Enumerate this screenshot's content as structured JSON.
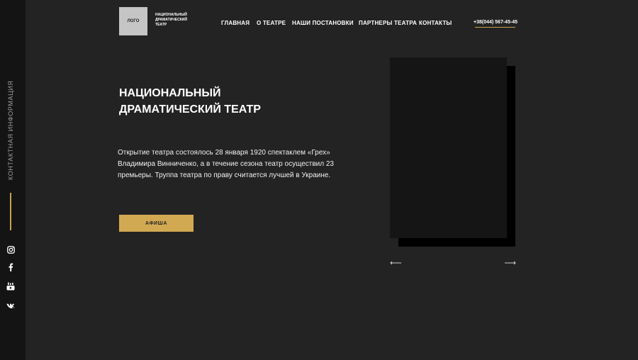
{
  "sidebar": {
    "contact_label": "КОНТАКТНАЯ ИНФОРМАЦИЯ",
    "social": [
      "instagram-icon",
      "facebook-icon",
      "youtube-icon",
      "vk-icon"
    ]
  },
  "header": {
    "logo_label": "ЛОГО",
    "logo_caption": "НАЦИОНАЛЬНЫЙ ДРАМАТИЧЕСКИЙ ТЕАТР",
    "nav": [
      "ГЛАВНАЯ",
      "О ТЕАТРЕ",
      "НАШИ ПОСТАНОВКИ",
      "ПАРТНЕРЫ ТЕАТРА",
      "КОНТАКТЫ"
    ],
    "phone": "+38(044) 567-45-45"
  },
  "hero": {
    "title_line1": "НАЦИОНАЛЬНЫЙ",
    "title_line2": "ДРАМАТИЧЕСКИЙ ТЕАТР",
    "description": "Открытие театра состоялось 28 января 1920 спектаклем «Грех» Владимира Винниченко, а в течение сезона театр осуществил 23 премьеры. Труппа театра по праву считается лучшей в Украине.",
    "button_label": "АФИША"
  },
  "slider": {
    "prev_icon": "arrow-left-icon",
    "next_icon": "arrow-right-icon"
  },
  "colors": {
    "accent": "#d2a953",
    "background": "#232323",
    "sidebar": "#141414"
  }
}
